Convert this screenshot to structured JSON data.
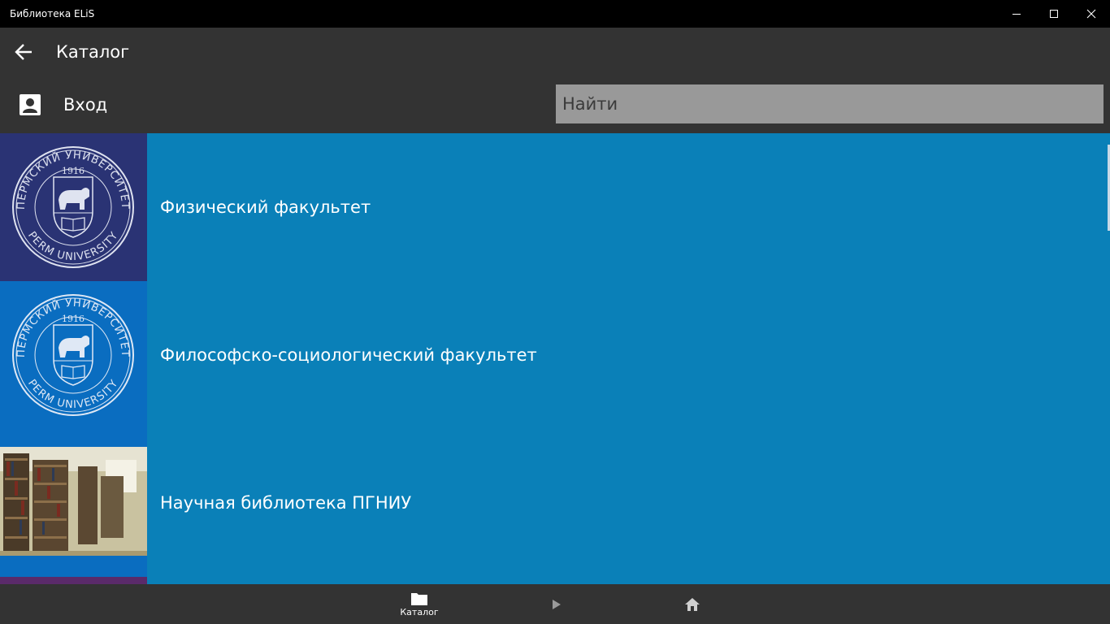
{
  "window": {
    "title": "Библиотека ELiS"
  },
  "header": {
    "title": "Каталог"
  },
  "login": {
    "label": "Вход"
  },
  "search": {
    "placeholder": "Найти"
  },
  "catalog": {
    "items": [
      {
        "label": "Физический факультет",
        "image": "perm-university-seal-logo",
        "thumb_color": "#2a3374"
      },
      {
        "label": "Философско-социологический факультет",
        "image": "perm-university-seal-logo",
        "thumb_color": "#0a6dc0"
      },
      {
        "label": "Научная библиотека ПГНИУ",
        "image": "library-bookshelves-photo",
        "thumb_color": "#5f6b4a"
      }
    ]
  },
  "seal": {
    "top_text": "ПЕРМСКИЙ УНИВЕРСИТЕТ",
    "bottom_text": "PERM UNIVERSITY",
    "year": "1916"
  },
  "bottom_nav": {
    "catalog_label": "Каталог"
  },
  "colors": {
    "titlebar": "#000000",
    "chrome": "#333333",
    "list_background": "#0a80b8",
    "search_background": "#999999"
  }
}
